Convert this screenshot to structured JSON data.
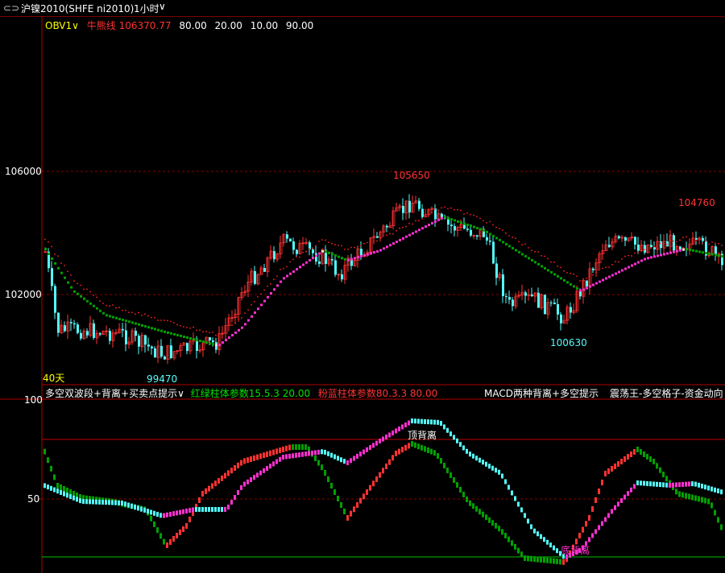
{
  "window": {
    "symbol": "沪镍2010(SHFE ni2010)",
    "period": "1小时",
    "period_chevron": "chevron-down-icon",
    "link_icon": "link-icon"
  },
  "upper_panel": {
    "indicator_name": "OBV1",
    "line_name": "牛熊线",
    "line_value": "106370.77",
    "params": [
      "80.00",
      "20.00",
      "10.00",
      "90.00"
    ],
    "y_ticks": [
      "106000",
      "102000"
    ],
    "annotations": {
      "high": "105650",
      "right_high": "104760",
      "low": "99470",
      "right_low": "100630",
      "days_label": "40天"
    }
  },
  "lower_panel": {
    "legends": {
      "main": "多空双波段+背离+买卖点提示",
      "red_green": "红绿柱体参数15.5.3 20.00",
      "pink_blue": "粉蓝柱体参数80.3.3 80.00",
      "macd": "MACD两种背离+多空提示",
      "zhendang": "震荡王-多空格子-资金动向"
    },
    "y_ticks": [
      "100",
      "50"
    ],
    "annotations": {
      "top_divergence": "顶背离",
      "bottom_divergence": "底背离"
    }
  },
  "colors": {
    "background": "#000000",
    "frame": "#b00000",
    "up": "#ff3232",
    "down": "#54fcfc",
    "green": "#00a000",
    "magenta": "#ff30d0",
    "yellow": "#ffff00",
    "grid_red": "#8b0000"
  }
}
